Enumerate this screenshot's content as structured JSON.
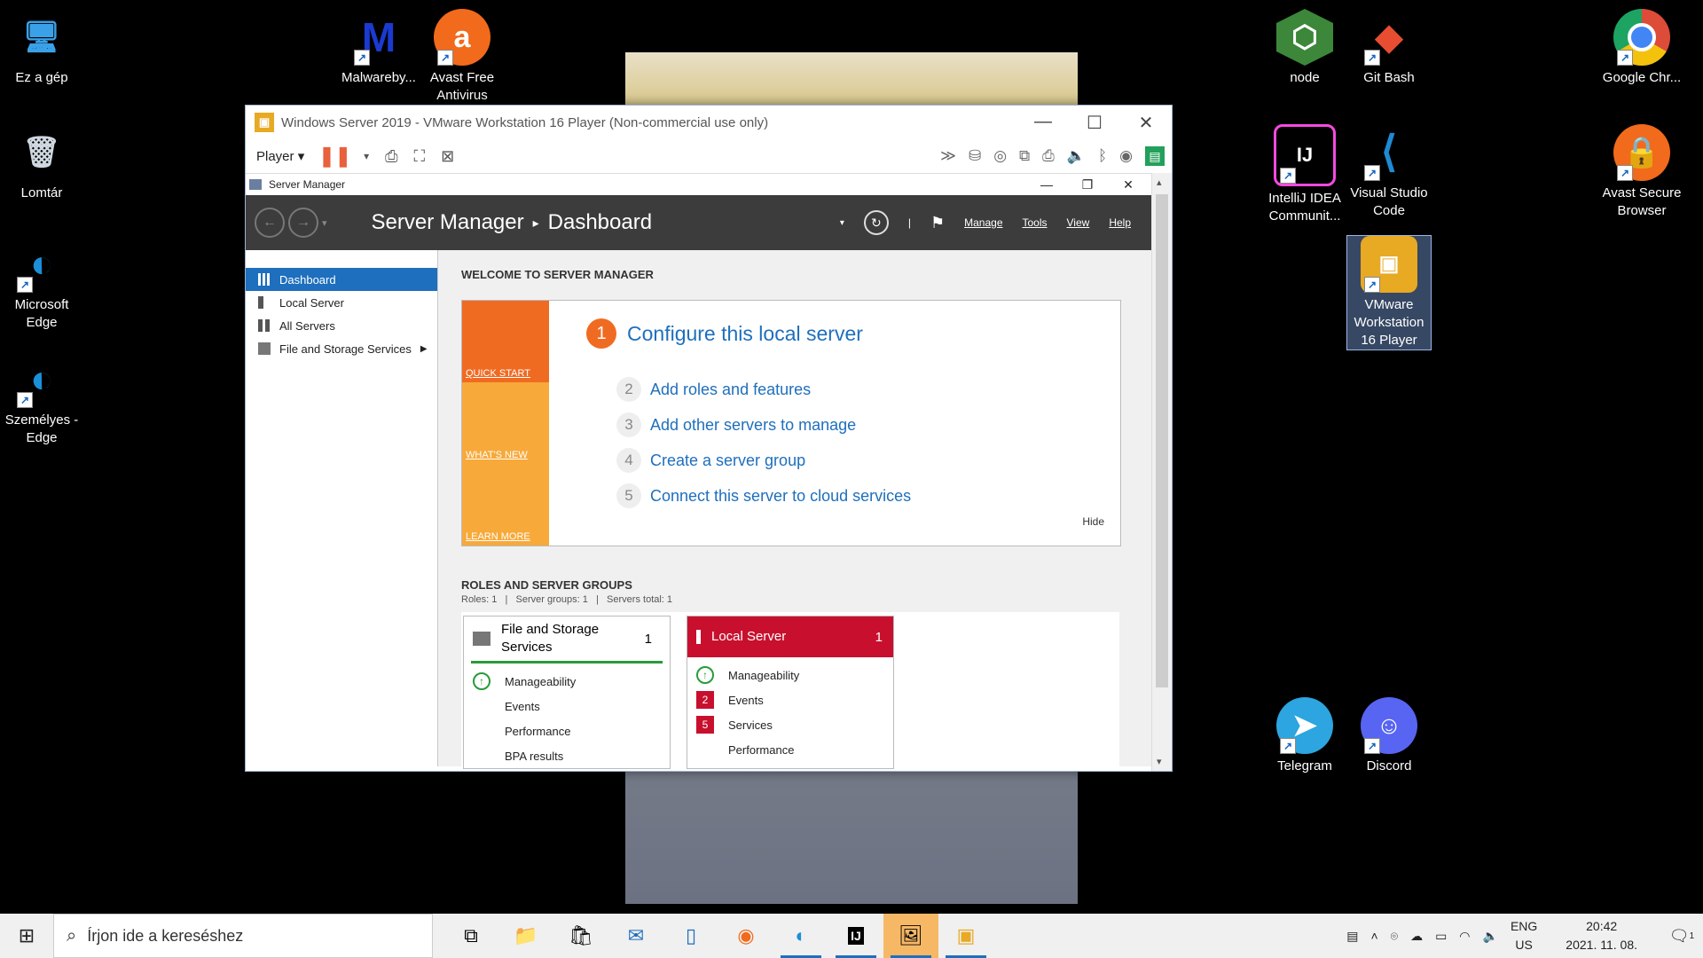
{
  "desktop": {
    "icons": [
      {
        "label": "Ez a gép",
        "icon": "computer-icon",
        "color": "#3aa0e8"
      },
      {
        "label": "Lomtár",
        "icon": "recycle-bin-icon",
        "color": "#cfd8e0"
      },
      {
        "label": "Microsoft Edge",
        "icon": "edge-icon",
        "color": "#1b8fd8"
      },
      {
        "label": "Személyes - Edge",
        "icon": "edge-profile-icon",
        "color": "#1b8fd8"
      },
      {
        "label": "Malwareby...",
        "icon": "malwarebytes-icon",
        "color": "#1a3ad0"
      },
      {
        "label": "Avast Free Antivirus",
        "icon": "avast-icon",
        "color": "#f26a1b"
      },
      {
        "label": "node",
        "icon": "node-icon",
        "color": "#3c873a"
      },
      {
        "label": "Git Bash",
        "icon": "git-bash-icon",
        "color": "#e84d31"
      },
      {
        "label": "Google Chr...",
        "icon": "chrome-icon",
        "color": "#dd4b39"
      },
      {
        "label": "IntelliJ IDEA Communit...",
        "icon": "intellij-icon",
        "color": "#000000"
      },
      {
        "label": "Visual Studio Code",
        "icon": "vscode-icon",
        "color": "#1f8ad2"
      },
      {
        "label": "Avast Secure Browser",
        "icon": "avast-browser-icon",
        "color": "#f26a1b"
      },
      {
        "label": "VMware Workstation 16 Player",
        "icon": "vmware-icon",
        "color": "#e8a923"
      },
      {
        "label": "Telegram",
        "icon": "telegram-icon",
        "color": "#2ca5e0"
      },
      {
        "label": "Discord",
        "icon": "discord-icon",
        "color": "#5865f2"
      }
    ]
  },
  "vmware": {
    "title": "Windows Server 2019 - VMware Workstation 16 Player (Non-commercial use only)",
    "player_menu": "Player"
  },
  "server_manager": {
    "window_title": "Server Manager",
    "breadcrumb_app": "Server Manager",
    "breadcrumb_page": "Dashboard",
    "menus": [
      "Manage",
      "Tools",
      "View",
      "Help"
    ],
    "sidebar": [
      {
        "label": "Dashboard",
        "active": true
      },
      {
        "label": "Local Server"
      },
      {
        "label": "All Servers"
      },
      {
        "label": "File and Storage Services"
      }
    ],
    "welcome_heading": "WELCOME TO SERVER MANAGER",
    "tiles": {
      "quick_start": "QUICK START",
      "whats_new": "WHAT'S NEW",
      "learn_more": "LEARN MORE"
    },
    "main_step": {
      "num": "1",
      "text": "Configure this local server"
    },
    "steps": [
      {
        "num": "2",
        "text": "Add roles and features"
      },
      {
        "num": "3",
        "text": "Add other servers to manage"
      },
      {
        "num": "4",
        "text": "Create a server group"
      },
      {
        "num": "5",
        "text": "Connect this server to cloud services"
      }
    ],
    "hide": "Hide",
    "roles_heading": "ROLES AND SERVER GROUPS",
    "roles_summary": "Roles: 1   |   Server groups: 1   |   Servers total: 1",
    "cards": [
      {
        "title": "File and Storage Services",
        "count": "1",
        "rows": [
          {
            "label": "Manageability",
            "mark": "↑"
          },
          {
            "label": "Events",
            "mark": ""
          },
          {
            "label": "Performance",
            "mark": ""
          },
          {
            "label": "BPA results",
            "mark": ""
          }
        ]
      },
      {
        "title": "Local Server",
        "count": "1",
        "rows": [
          {
            "label": "Manageability",
            "mark": "↑"
          },
          {
            "label": "Events",
            "mark": "2"
          },
          {
            "label": "Services",
            "mark": "5"
          },
          {
            "label": "Performance",
            "mark": ""
          }
        ]
      }
    ]
  },
  "taskbar": {
    "search_placeholder": "Írjon ide a kereséshez",
    "lang_top": "ENG",
    "lang_bottom": "US",
    "time": "20:42",
    "date": "2021. 11. 08.",
    "notification_count": "1"
  },
  "colors": {
    "accent": "#1e6fbd",
    "quick_start": "#f06b22",
    "tile_orange": "#f7a93a",
    "alert_red": "#c8102e"
  }
}
